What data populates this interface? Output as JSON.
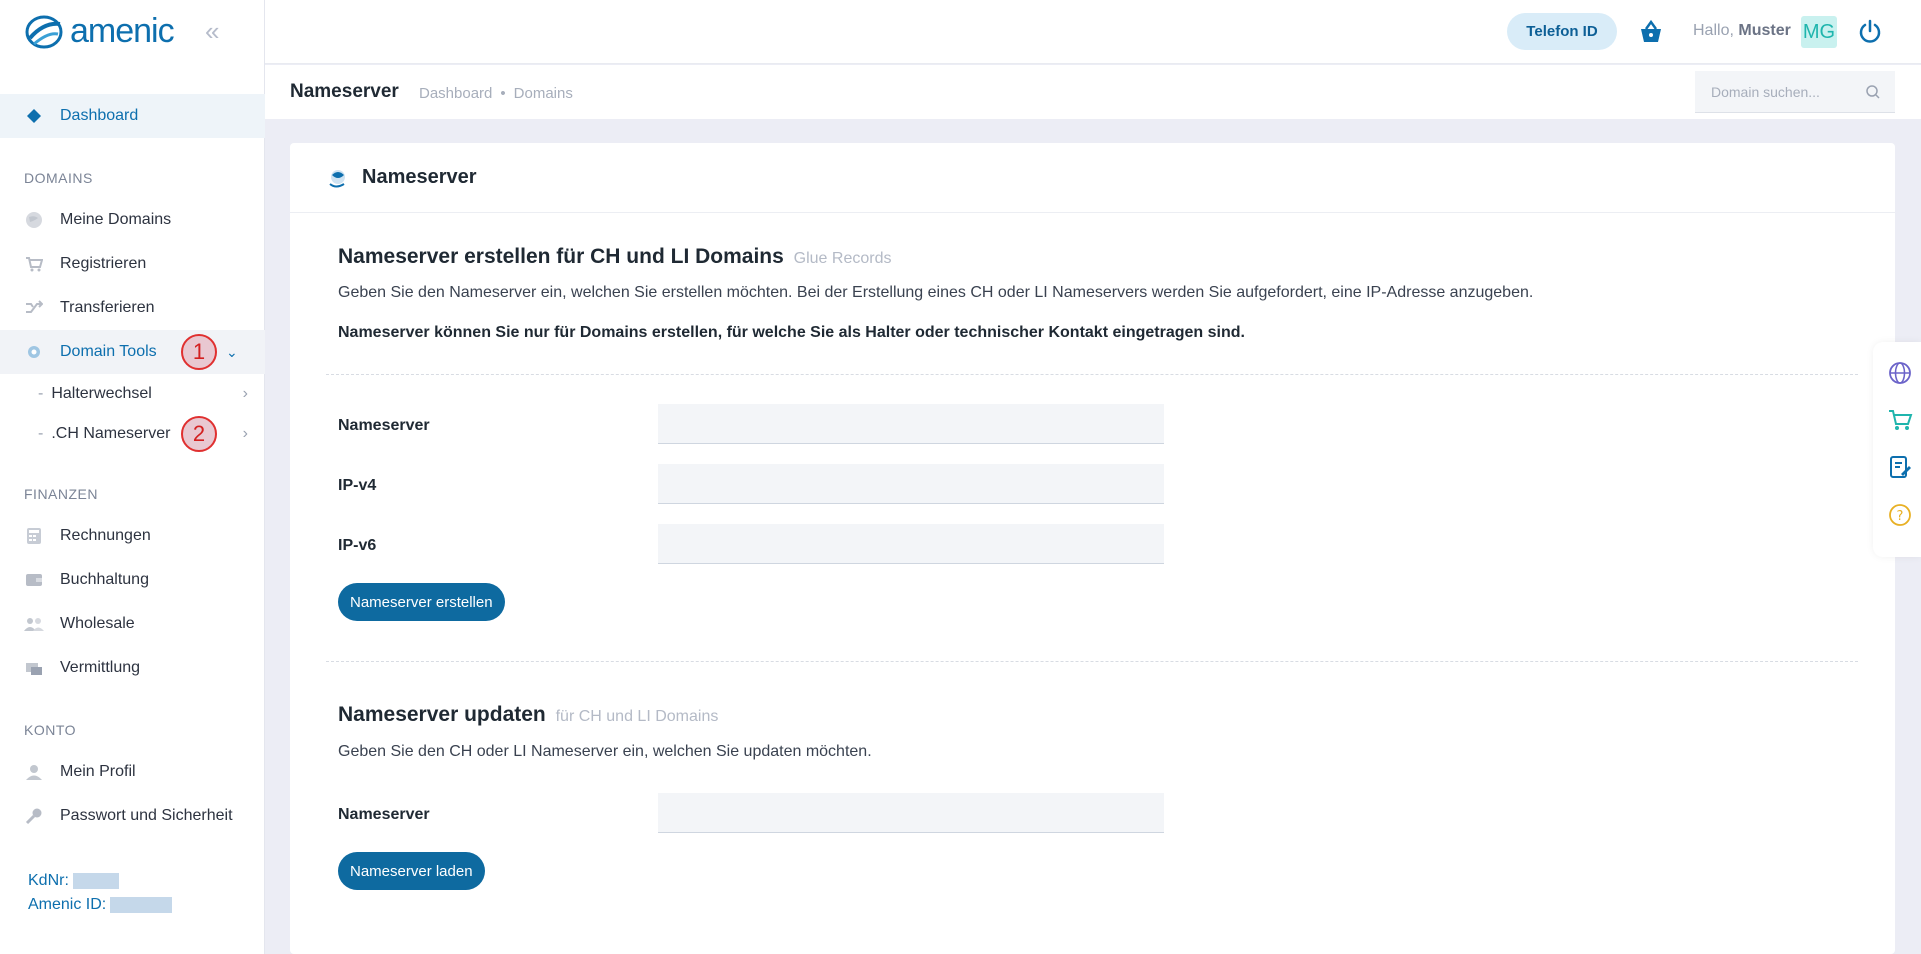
{
  "brand": {
    "name": "amenic",
    "color": "#0d6fae"
  },
  "sidebar": {
    "dashboard": {
      "label": "Dashboard",
      "icon": "diamond-icon"
    },
    "sections": {
      "domains": "DOMAINS",
      "finanzen": "FINANZEN",
      "konto": "KONTO"
    },
    "domains_items": [
      {
        "label": "Meine Domains",
        "icon": "globe-icon"
      },
      {
        "label": "Registrieren",
        "icon": "cart-icon"
      },
      {
        "label": "Transferieren",
        "icon": "shuffle-icon"
      },
      {
        "label": "Domain Tools",
        "icon": "gear-icon"
      }
    ],
    "domain_tools_sub": [
      {
        "label": "Halterwechsel"
      },
      {
        "label": ".CH Nameserver"
      }
    ],
    "markers": [
      "1",
      "2"
    ],
    "finanzen_items": [
      {
        "label": "Rechnungen",
        "icon": "calculator-icon"
      },
      {
        "label": "Buchhaltung",
        "icon": "wallet-icon"
      },
      {
        "label": "Wholesale",
        "icon": "users-icon"
      },
      {
        "label": "Vermittlung",
        "icon": "handshake-icon"
      }
    ],
    "konto_items": [
      {
        "label": "Mein Profil",
        "icon": "user-icon"
      },
      {
        "label": "Passwort und Sicherheit",
        "icon": "key-icon"
      }
    ],
    "kdnr_label": "KdNr:",
    "amenic_id_label": "Amenic ID:"
  },
  "topbar": {
    "phone_id": "Telefon ID",
    "greeting": "Hallo,",
    "username": "Muster",
    "avatar_initials": "MG"
  },
  "subheader": {
    "title": "Nameserver",
    "breadcrumb": [
      "Dashboard",
      "•",
      "Domains"
    ],
    "search_placeholder": "Domain suchen..."
  },
  "card": {
    "title": "Nameserver",
    "create": {
      "heading": "Nameserver erstellen für CH und LI Domains",
      "heading_muted": "Glue Records",
      "description": "Geben Sie den Nameserver ein, welchen Sie erstellen möchten. Bei der Erstellung eines CH oder LI Nameservers werden Sie aufgefordert, eine IP-Adresse anzugeben.",
      "note": "Nameserver können Sie nur für Domains erstellen, für welche Sie als Halter oder technischer Kontakt eingetragen sind.",
      "fields": [
        {
          "label": "Nameserver",
          "value": ""
        },
        {
          "label": "IP-v4",
          "value": ""
        },
        {
          "label": "IP-v6",
          "value": ""
        }
      ],
      "button": "Nameserver erstellen"
    },
    "update": {
      "heading": "Nameserver updaten",
      "heading_muted": "für CH und LI Domains",
      "description": "Geben Sie den CH oder LI Nameserver ein, welchen Sie updaten möchten.",
      "field_label": "Nameserver",
      "field_value": "",
      "button": "Nameserver laden"
    }
  },
  "floatbar": [
    "globe-icon",
    "cart-icon",
    "document-edit-icon",
    "help-icon"
  ],
  "colors": {
    "accent": "#0e6aa0",
    "marker": "#e03030",
    "background": "#ecedf5"
  }
}
